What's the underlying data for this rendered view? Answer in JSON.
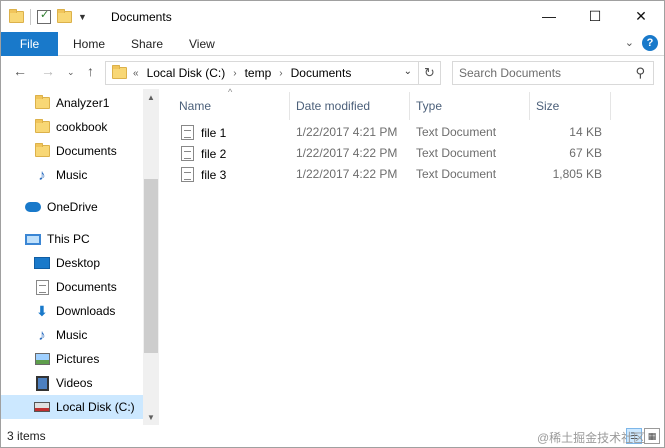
{
  "window": {
    "title": "Documents",
    "controls": {
      "minimize": "—",
      "maximize": "☐",
      "close": "✕"
    }
  },
  "ribbon": {
    "file_tab": "File",
    "tabs": [
      "Home",
      "Share",
      "View"
    ],
    "accent_color": "#1979ca"
  },
  "address": {
    "overflow": "«",
    "crumbs": [
      "Local Disk (C:)",
      "temp",
      "Documents"
    ],
    "search_placeholder": "Search Documents"
  },
  "nav_pane": {
    "items": [
      {
        "label": "Analyzer1",
        "icon": "folder-icon"
      },
      {
        "label": "cookbook",
        "icon": "folder-icon"
      },
      {
        "label": "Documents",
        "icon": "folder-icon"
      },
      {
        "label": "Music",
        "icon": "music-icon"
      },
      {
        "label": "OneDrive",
        "icon": "onedrive-icon"
      },
      {
        "label": "This PC",
        "icon": "computer-icon"
      },
      {
        "label": "Desktop",
        "icon": "desktop-icon"
      },
      {
        "label": "Documents",
        "icon": "documents-icon"
      },
      {
        "label": "Downloads",
        "icon": "downloads-icon"
      },
      {
        "label": "Music",
        "icon": "music-icon"
      },
      {
        "label": "Pictures",
        "icon": "pictures-icon"
      },
      {
        "label": "Videos",
        "icon": "videos-icon"
      },
      {
        "label": "Local Disk (C:)",
        "icon": "disk-icon",
        "selected": true
      }
    ]
  },
  "file_list": {
    "columns": {
      "name": "Name",
      "date": "Date modified",
      "type": "Type",
      "size": "Size"
    },
    "rows": [
      {
        "name": "file 1",
        "date": "1/22/2017 4:21 PM",
        "type": "Text Document",
        "size": "14 KB"
      },
      {
        "name": "file 2",
        "date": "1/22/2017 4:22 PM",
        "type": "Text Document",
        "size": "67 KB"
      },
      {
        "name": "file 3",
        "date": "1/22/2017 4:22 PM",
        "type": "Text Document",
        "size": "1,805 KB"
      }
    ]
  },
  "status": {
    "item_count": "3 items",
    "watermark": "@稀土掘金技术社区"
  }
}
